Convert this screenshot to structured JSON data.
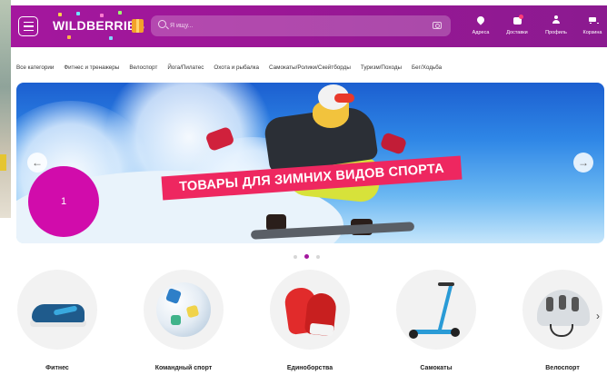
{
  "header": {
    "logo": "WILDBERRIES",
    "search_placeholder": "Я ищу...",
    "nav": [
      {
        "label": "Адреса",
        "icon": "location-pin-icon"
      },
      {
        "label": "Доставки",
        "icon": "delivery-box-icon"
      },
      {
        "label": "Профиль",
        "icon": "profile-icon"
      },
      {
        "label": "Корзина",
        "icon": "cart-icon"
      }
    ],
    "brand_color": "#a4179e"
  },
  "categories_nav": [
    "Все категории",
    "Фитнес и тренажеры",
    "Велоспорт",
    "Йога/Пилатес",
    "Охота и рыбалка",
    "Самокаты/Ролики/Скейтборды",
    "Туризм/Походы",
    "Бег/Ходьба"
  ],
  "banner": {
    "promo_text": "ТОВАРЫ ДЛЯ ЗИМНИХ ВИДОВ СПОРТА",
    "prev_arrow": "←",
    "next_arrow": "→",
    "promo_color": "#ee2760"
  },
  "annotation": {
    "label": "1",
    "color": "#d10cab"
  },
  "carousel": {
    "dots_count": 3,
    "active_index": 1
  },
  "sport_categories": [
    {
      "label": "Фитнес",
      "icon": "sneaker-icon"
    },
    {
      "label": "Командный спорт",
      "icon": "soccer-ball-icon"
    },
    {
      "label": "Единоборства",
      "icon": "boxing-gloves-icon"
    },
    {
      "label": "Самокаты",
      "icon": "scooter-icon"
    },
    {
      "label": "Велоспорт",
      "icon": "bike-helmet-icon"
    }
  ],
  "more_arrow": "›"
}
